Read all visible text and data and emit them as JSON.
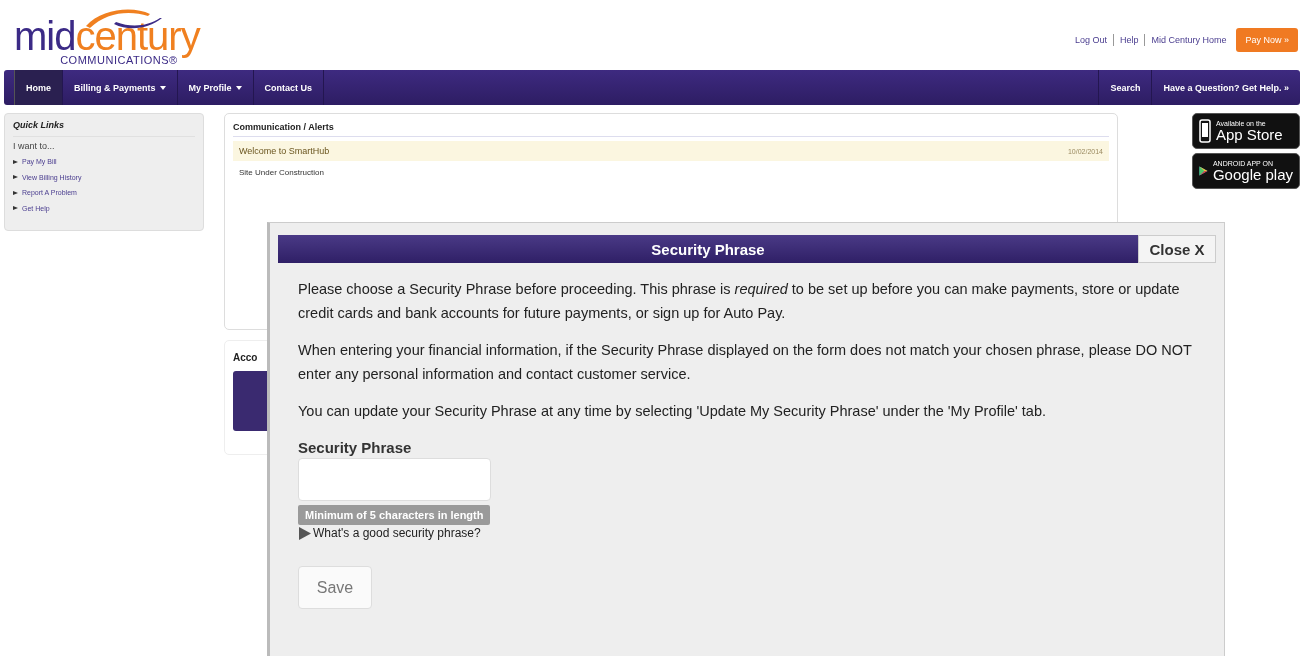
{
  "logo": {
    "part_1": "mid",
    "part_2": "century",
    "tagline": "COMMUNICATIONS®"
  },
  "top_links": [
    "Log Out",
    "Help",
    "Mid Century Home"
  ],
  "pay_button": "Pay Now »",
  "nav": {
    "left": [
      {
        "label": "Home",
        "selected": true,
        "dropdown": false
      },
      {
        "label": "Billing & Payments",
        "selected": false,
        "dropdown": true
      },
      {
        "label": "My Profile",
        "selected": false,
        "dropdown": true
      },
      {
        "label": "Contact Us",
        "selected": false,
        "dropdown": false
      }
    ],
    "right": [
      "Search",
      "Have a Question? Get Help. »"
    ]
  },
  "quick_links": {
    "title": "Quick Links",
    "intro": "I want to...",
    "items": [
      "Pay My Bill",
      "View Billing History",
      "Report A Problem",
      "Get Help"
    ]
  },
  "alerts": {
    "title": "Communication / Alerts",
    "rows": [
      {
        "text": "Welcome to SmartHub",
        "date": "10/02/2014",
        "highlighted": true
      },
      {
        "text": "Site Under Construction",
        "highlighted": false
      }
    ]
  },
  "accounts": {
    "title": "Acco"
  },
  "store_badges": [
    {
      "kind": "apple",
      "small": "Available on the",
      "big": "App Store"
    },
    {
      "kind": "google",
      "small": "ANDROID APP ON",
      "big": "Google play"
    }
  ],
  "modal": {
    "title": "Security Phrase",
    "close": "Close X",
    "paragraphs": [
      "Please choose a Security Phrase before proceeding. This phrase is *required* to be set up before you can make payments, store or update credit cards and bank accounts for future payments, or sign up for Auto Pay.",
      "When entering your financial information, if the Security Phrase displayed on the form does not match your chosen phrase, please DO NOT enter any personal information and contact customer service.",
      "You can update your Security Phrase at any time by selecting 'Update My Security Phrase' under the 'My Profile' tab."
    ],
    "field_label": "Security Phrase",
    "hint": "Minimum of 5 characters in length",
    "help_toggle": {
      "label": "What's a good security phrase?",
      "expanded": false
    },
    "save": "Save"
  }
}
